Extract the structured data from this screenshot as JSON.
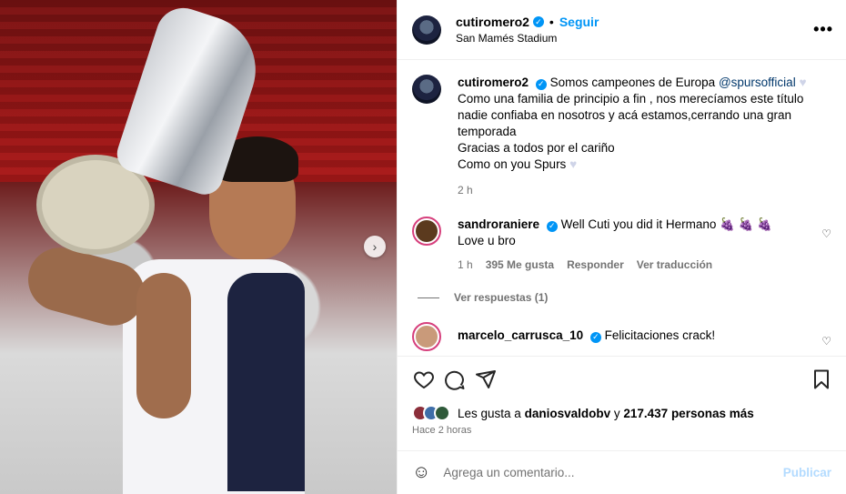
{
  "post": {
    "author": "cutiromero2",
    "follow_label": "Seguir",
    "location": "San Mamés Stadium",
    "more_icon": "more-options-icon",
    "next_icon": "chevron-right-icon"
  },
  "caption": {
    "user": "cutiromero2",
    "text_1": "Somos campeones de Europa",
    "mention": "@spursofficial",
    "text_2": "Como una familia de principio a fin , nos merecíamos este título nadie confiaba en nosotros y acá estamos,cerrando una gran temporada",
    "text_3": "Gracias a todos por el cariño",
    "text_4": "Como on you Spurs",
    "time": "2 h"
  },
  "comments": [
    {
      "user": "sandroraniere",
      "line_1": "Well Cuti you did it Hermano",
      "emojis": "🍇 🍇 🍇",
      "line_2": "Love u bro",
      "time": "1 h",
      "likes": "395 Me gusta",
      "reply": "Responder",
      "translate": "Ver traducción",
      "view_replies": "Ver respuestas (1)"
    },
    {
      "user": "marcelo_carrusca_10",
      "line_1": "Felicitaciones crack!"
    }
  ],
  "likes": {
    "prefix": "Les gusta a",
    "user": "daniosvaldobv",
    "middle": "y",
    "count": "217.437 personas más"
  },
  "posted": "Hace 2 horas",
  "add_comment": {
    "placeholder": "Agrega un comentario...",
    "publish": "Publicar"
  },
  "colors": {
    "accent": "#0095f6",
    "publish_disabled": "#b3dbff",
    "muted": "#737373"
  }
}
